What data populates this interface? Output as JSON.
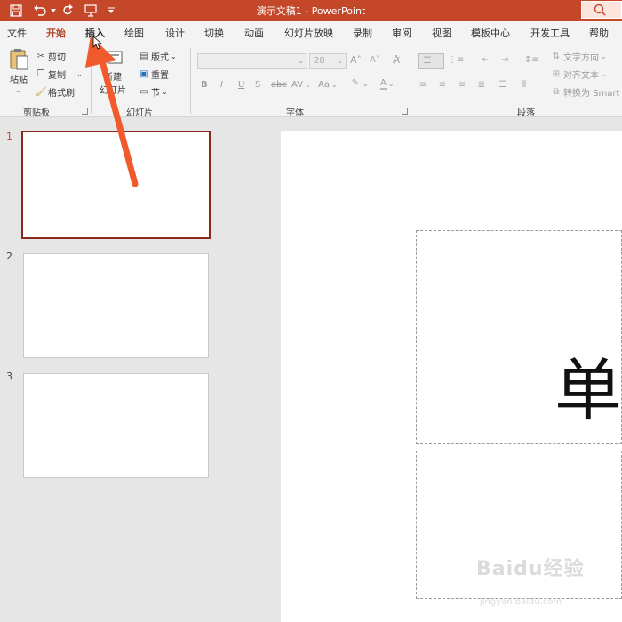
{
  "titlebar": {
    "title": "演示文稿1  -  PowerPoint",
    "color": "#c4472a"
  },
  "quick_access": {
    "save_icon": "save-icon",
    "undo_icon": "undo-icon",
    "redo_icon": "redo-icon",
    "present_icon": "present-icon",
    "customize_icon": "customize-icon"
  },
  "tabs": [
    {
      "label": "文件"
    },
    {
      "label": "开始"
    },
    {
      "label": "插入"
    },
    {
      "label": "绘图"
    },
    {
      "label": "设计"
    },
    {
      "label": "切换"
    },
    {
      "label": "动画"
    },
    {
      "label": "幻灯片放映"
    },
    {
      "label": "录制"
    },
    {
      "label": "审阅"
    },
    {
      "label": "视图"
    },
    {
      "label": "模板中心"
    },
    {
      "label": "开发工具"
    },
    {
      "label": "帮助"
    }
  ],
  "active_tab": "开始",
  "ribbon": {
    "clipboard": {
      "paste": "粘贴",
      "cut": "剪切",
      "copy": "复制",
      "format_painter": "格式刷",
      "group": "剪贴板"
    },
    "slides": {
      "new_slide_top": "新建",
      "new_slide_bottom": "幻灯片",
      "layout": "版式",
      "reset": "重置",
      "section": "节",
      "group": "幻灯片"
    },
    "font": {
      "size": "28",
      "group": "字体",
      "bold": "B",
      "italic": "I",
      "underline": "U",
      "shadow": "S",
      "strike": "abc",
      "spacing": "AV",
      "case": "Aa",
      "color": "A"
    },
    "paragraph": {
      "text_direction": "文字方向",
      "align_text": "对齐文本",
      "convert_smartart": "转换为 Smart",
      "group": "段落"
    }
  },
  "slides_panel": {
    "slides": [
      {
        "number": "1"
      },
      {
        "number": "2"
      },
      {
        "number": "3"
      }
    ],
    "selected": "1"
  },
  "slide_content": {
    "big_char": "单"
  },
  "watermark": {
    "text": "Baidu经验",
    "sub": "jingyan.baidu.com"
  },
  "annotation": {
    "arrow_color": "#f05a2d"
  }
}
